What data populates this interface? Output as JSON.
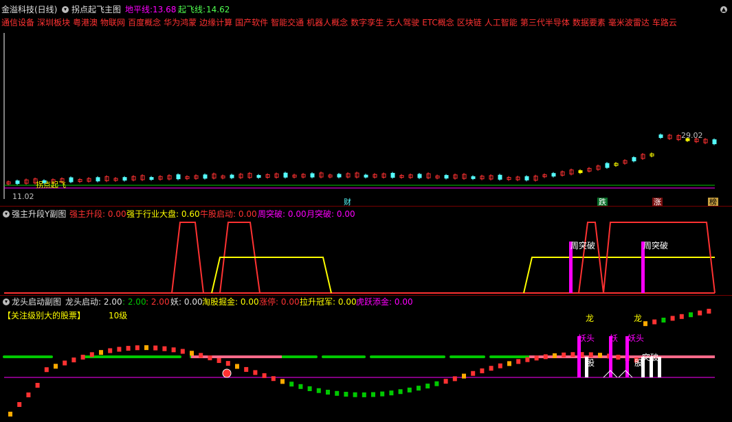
{
  "main_panel": {
    "title": "金溢科技(日线)",
    "indicator_name": "拐点起飞主图",
    "ground_line_label": "地平线:",
    "ground_line_value": "13.68",
    "takeoff_line_label": "起飞线:",
    "takeoff_line_value": "14.62",
    "sector_tags": [
      "通信设备",
      "深圳板块",
      "粤港澳",
      "物联网",
      "百度概念",
      "华为鸿蒙",
      "边缘计算",
      "国产软件",
      "智能交通",
      "机器人概念",
      "数字孪生",
      "无人驾驶",
      "ETC概念",
      "区块链",
      "人工智能",
      "第三代半导体",
      "数据要素",
      "毫米波雷达",
      "车路云"
    ],
    "high_marker": "29.02",
    "low_marker": "11.02",
    "signal_label": "拐点起飞",
    "bottom_markers": [
      "财",
      "跌",
      "涨",
      "榜"
    ]
  },
  "sub_panel_1": {
    "title": "强主升段Y副图",
    "items": [
      {
        "label": "强主升段:",
        "value": "0.00"
      },
      {
        "label": "强于行业大盘:",
        "value": "0.60"
      },
      {
        "label": "牛股启动:",
        "value": "0.00"
      },
      {
        "label": "周突破:",
        "value": "0.00"
      },
      {
        "label": "月突破:",
        "value": "0.00"
      }
    ],
    "annotations": [
      "周突破",
      "周突破"
    ]
  },
  "sub_panel_2": {
    "title": "龙头启动副图",
    "items": [
      {
        "label": "龙头启动:",
        "value": "2.00"
      },
      {
        "label": "",
        "value": ": 2.00"
      },
      {
        "label": "",
        "value": ": 2.00"
      },
      {
        "label": "妖:",
        "value": "0.00"
      },
      {
        "label": "淘股掘金:",
        "value": "0.00"
      },
      {
        "label": "涨停:",
        "value": "0.00"
      },
      {
        "label": "拉升冠军:",
        "value": "0.00"
      },
      {
        "label": "虎跃添金:",
        "value": "0.00"
      }
    ],
    "notice": "【关注级别大的股票】",
    "level": "10级",
    "labels_dragon": [
      "龙",
      "龙"
    ],
    "labels_yao": [
      "妖头",
      "妖",
      "妖头"
    ],
    "labels_gu": [
      "股",
      "股"
    ],
    "labels_tu": [
      "突破"
    ]
  },
  "colors": {
    "background": "#000000",
    "up": "#ff3232",
    "down": "#54fcfc",
    "yellow": "#ffff00",
    "magenta": "#ff00ff",
    "green": "#00c800",
    "divider": "#7a0000"
  }
}
